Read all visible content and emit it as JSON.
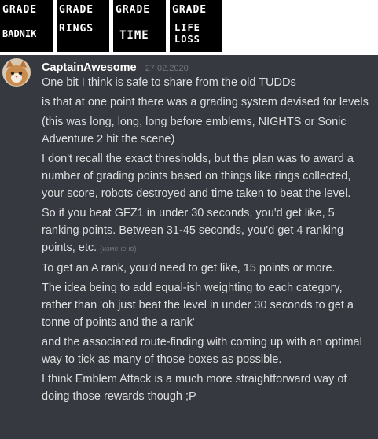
{
  "banner": {
    "tiles": [
      {
        "top": "GRADE",
        "bottom": "BADNIK"
      },
      {
        "top": "GRADE",
        "bottom": "RINGS"
      },
      {
        "top": "GRADE",
        "bottom": "TIME"
      },
      {
        "top": "GRADE",
        "bottom": "LIFE\nLOSS"
      }
    ]
  },
  "message": {
    "username": "CaptainAwesome",
    "timestamp": "27.02.2020",
    "lines": [
      "One bit I think is safe to share from the old TUDDs",
      "is that at one point there was a grading system devised for levels",
      "(this was long, long, long before emblems, NIGHTS or Sonic Adventure 2 hit the scene)",
      "I don't recall the exact thresholds, but the plan was to award a number of grading points based on things like rings collected, your score, robots destroyed and time taken to beat the level.",
      "So if you beat GFZ1 in under 30 seconds, you'd get like, 5 ranking points. Between 31-45 seconds, you'd get 4 ranking points, etc.",
      "To get an A rank, you'd need to get like, 15 points or more.",
      "The idea being to add equal-ish weighting to each category, rather than 'oh just beat the level in under 30 seconds to get a tonne of points and the a rank'",
      "and the associated route-finding with coming up with an optimal way to tick as many of those boxes as possible.",
      "I think Emblem Attack is a much more straightforward way of doing those rewards though ;P"
    ],
    "edited_label": "(изменено)"
  },
  "colors": {
    "background": "#36393f",
    "username": "#ffffff",
    "text": "#dcddde",
    "muted": "#72767d"
  }
}
